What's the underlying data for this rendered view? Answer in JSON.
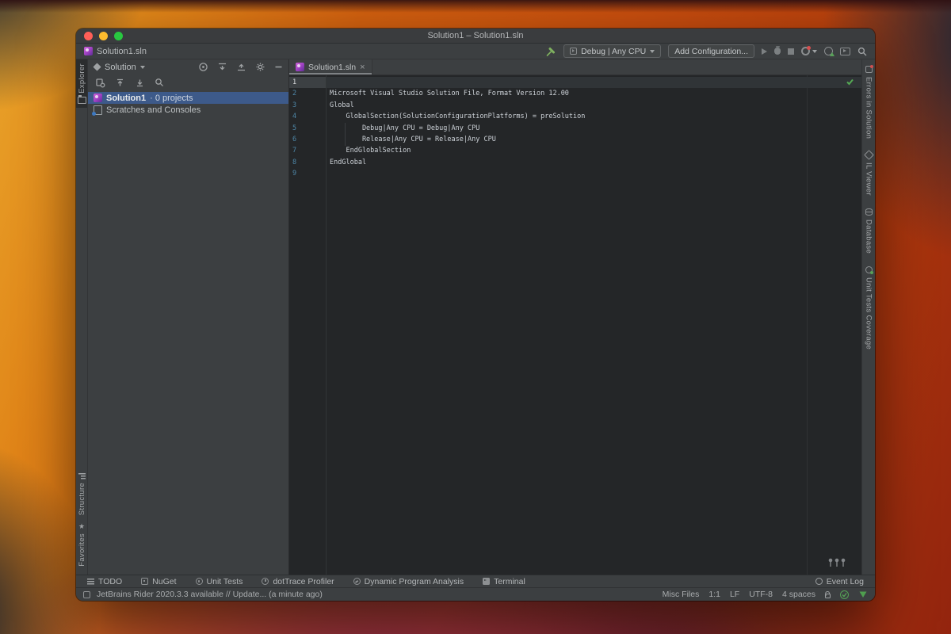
{
  "window": {
    "title": "Solution1 – Solution1.sln"
  },
  "toolbar": {
    "breadcrumb_file": "Solution1.sln",
    "run_config_label": "Debug | Any CPU",
    "add_configuration_label": "Add Configuration..."
  },
  "left_stripe": {
    "explorer": "Explorer",
    "structure": "Structure",
    "favorites": "Favorites"
  },
  "solution_panel": {
    "title": "Solution",
    "tree": [
      {
        "icon": "sln",
        "label": "Solution1",
        "detail": "· 0 projects",
        "selected": true
      },
      {
        "icon": "scratches",
        "label": "Scratches and Consoles",
        "detail": "",
        "selected": false
      }
    ]
  },
  "editor": {
    "tab_label": "Solution1.sln",
    "lines": [
      {
        "no": "1",
        "text": "",
        "current": true
      },
      {
        "no": "2",
        "text": "Microsoft Visual Studio Solution File, Format Version 12.00",
        "current": false
      },
      {
        "no": "3",
        "text": "Global",
        "current": false
      },
      {
        "no": "4",
        "text": "    GlobalSection(SolutionConfigurationPlatforms) = preSolution",
        "current": false
      },
      {
        "no": "5",
        "text": "        Debug|Any CPU = Debug|Any CPU",
        "current": false
      },
      {
        "no": "6",
        "text": "        Release|Any CPU = Release|Any CPU",
        "current": false
      },
      {
        "no": "7",
        "text": "    EndGlobalSection",
        "current": false
      },
      {
        "no": "8",
        "text": "EndGlobal",
        "current": false
      },
      {
        "no": "9",
        "text": "",
        "current": false
      }
    ]
  },
  "right_stripe": {
    "tabs": [
      {
        "icon": "errors",
        "label": "Errors in Solution"
      },
      {
        "icon": "il",
        "label": "IL Viewer"
      },
      {
        "icon": "db",
        "label": "Database"
      },
      {
        "icon": "coverage",
        "label": "Unit Tests Coverage"
      }
    ]
  },
  "bottom_bar": {
    "items": [
      {
        "icon": "todo",
        "label": "TODO"
      },
      {
        "icon": "nuget",
        "label": "NuGet"
      },
      {
        "icon": "unittests",
        "label": "Unit Tests"
      },
      {
        "icon": "dottrace",
        "label": "dotTrace Profiler"
      },
      {
        "icon": "dpa",
        "label": "Dynamic Program Analysis"
      },
      {
        "icon": "terminal",
        "label": "Terminal"
      }
    ],
    "event_log_label": "Event Log"
  },
  "status_bar": {
    "message": "JetBrains Rider 2020.3.3 available // Update... (a minute ago)",
    "items": [
      "Misc Files",
      "1:1",
      "LF",
      "UTF-8",
      "4 spaces"
    ]
  },
  "colors": {
    "panel_bg": "#3c3f41",
    "editor_bg": "#242628",
    "selection_blue": "#3d5a8a",
    "line_number_teal": "#4e87a8",
    "ok_green": "#55a055",
    "sln_purple": "#9a3fc0"
  }
}
